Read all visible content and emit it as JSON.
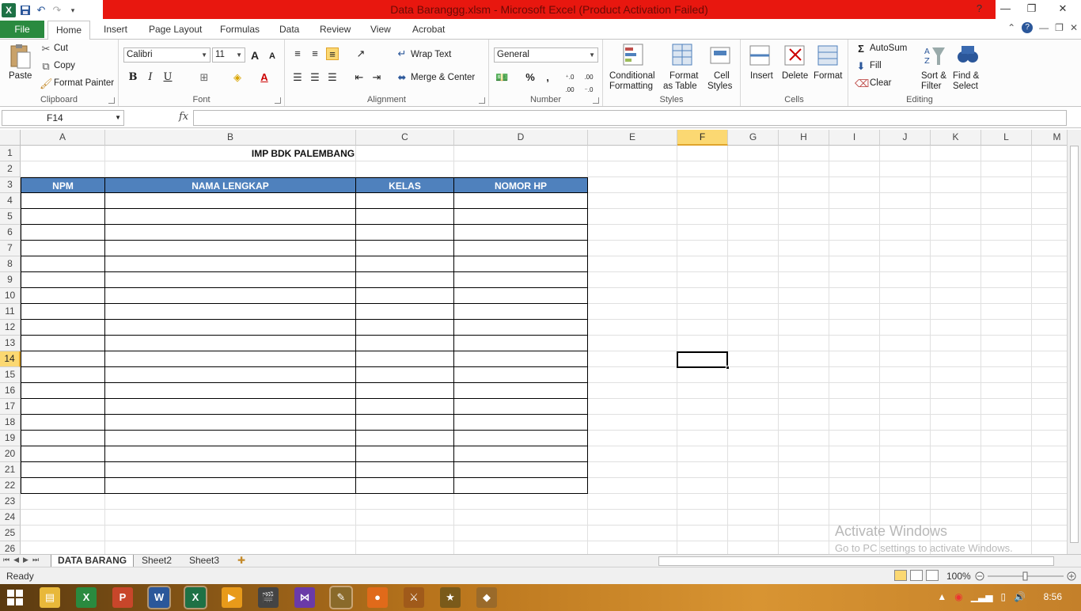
{
  "window": {
    "title": "Data Baranggg.xlsm  -  Microsoft Excel (Product Activation Failed)",
    "controls": {
      "minimize": "—",
      "maximize": "❐",
      "close": "✕"
    }
  },
  "ribbon_tabs": [
    "File",
    "Home",
    "Insert",
    "Page Layout",
    "Formulas",
    "Data",
    "Review",
    "View",
    "Acrobat"
  ],
  "ribbon": {
    "clipboard": {
      "group": "Clipboard",
      "paste": "Paste",
      "cut": "Cut",
      "copy": "Copy",
      "format_painter": "Format Painter"
    },
    "font": {
      "group": "Font",
      "name": "Calibri",
      "size": "11",
      "bold": "B",
      "italic": "I",
      "underline": "U",
      "grow": "A",
      "shrink": "A"
    },
    "alignment": {
      "group": "Alignment",
      "wrap_text": "Wrap Text",
      "merge_center": "Merge & Center"
    },
    "number": {
      "group": "Number",
      "format": "General",
      "percent": "%",
      "comma": ",",
      "inc_decimal": "⁺.0 .00",
      "dec_decimal": ".00 ⁻.0"
    },
    "styles": {
      "group": "Styles",
      "conditional_1": "Conditional",
      "conditional_2": "Formatting",
      "format_table_1": "Format",
      "format_table_2": "as Table",
      "cell_styles_1": "Cell",
      "cell_styles_2": "Styles"
    },
    "cells": {
      "group": "Cells",
      "insert": "Insert",
      "delete": "Delete",
      "format": "Format"
    },
    "editing": {
      "group": "Editing",
      "autosum": "AutoSum",
      "fill": "Fill",
      "clear": "Clear",
      "sort_1": "Sort &",
      "sort_2": "Filter",
      "find_1": "Find &",
      "find_2": "Select"
    }
  },
  "formula_bar": {
    "name_box": "F14",
    "fx": "fx",
    "value": ""
  },
  "columns": [
    "A",
    "B",
    "C",
    "D",
    "E",
    "F",
    "G",
    "H",
    "I",
    "J",
    "K",
    "L",
    "M"
  ],
  "active_column": "F",
  "rows": [
    "1",
    "2",
    "3",
    "4",
    "5",
    "6",
    "7",
    "8",
    "9",
    "10",
    "11",
    "12",
    "13",
    "14",
    "15",
    "16",
    "17",
    "18",
    "19",
    "20",
    "21",
    "22",
    "23",
    "24",
    "25",
    "26"
  ],
  "active_row": "14",
  "sheet": {
    "title": "IMP BDK PALEMBANG",
    "headers": [
      "NPM",
      "NAMA LENGKAP",
      "KELAS",
      "NOMOR HP"
    ],
    "header_color": "#4f81bd"
  },
  "watermark": {
    "line1": "Activate Windows",
    "line2": "Go to PC settings to activate Windows."
  },
  "sheet_tabs": [
    "DATA BARANG",
    "Sheet2",
    "Sheet3"
  ],
  "status": {
    "ready": "Ready",
    "zoom": "100%"
  },
  "taskbar": {
    "time": "8:56"
  },
  "colors": {
    "excel_green": "#1e7145",
    "title_red": "#e8170f",
    "file_tab": "#2a8a3f",
    "active_header": "#fbd872"
  }
}
